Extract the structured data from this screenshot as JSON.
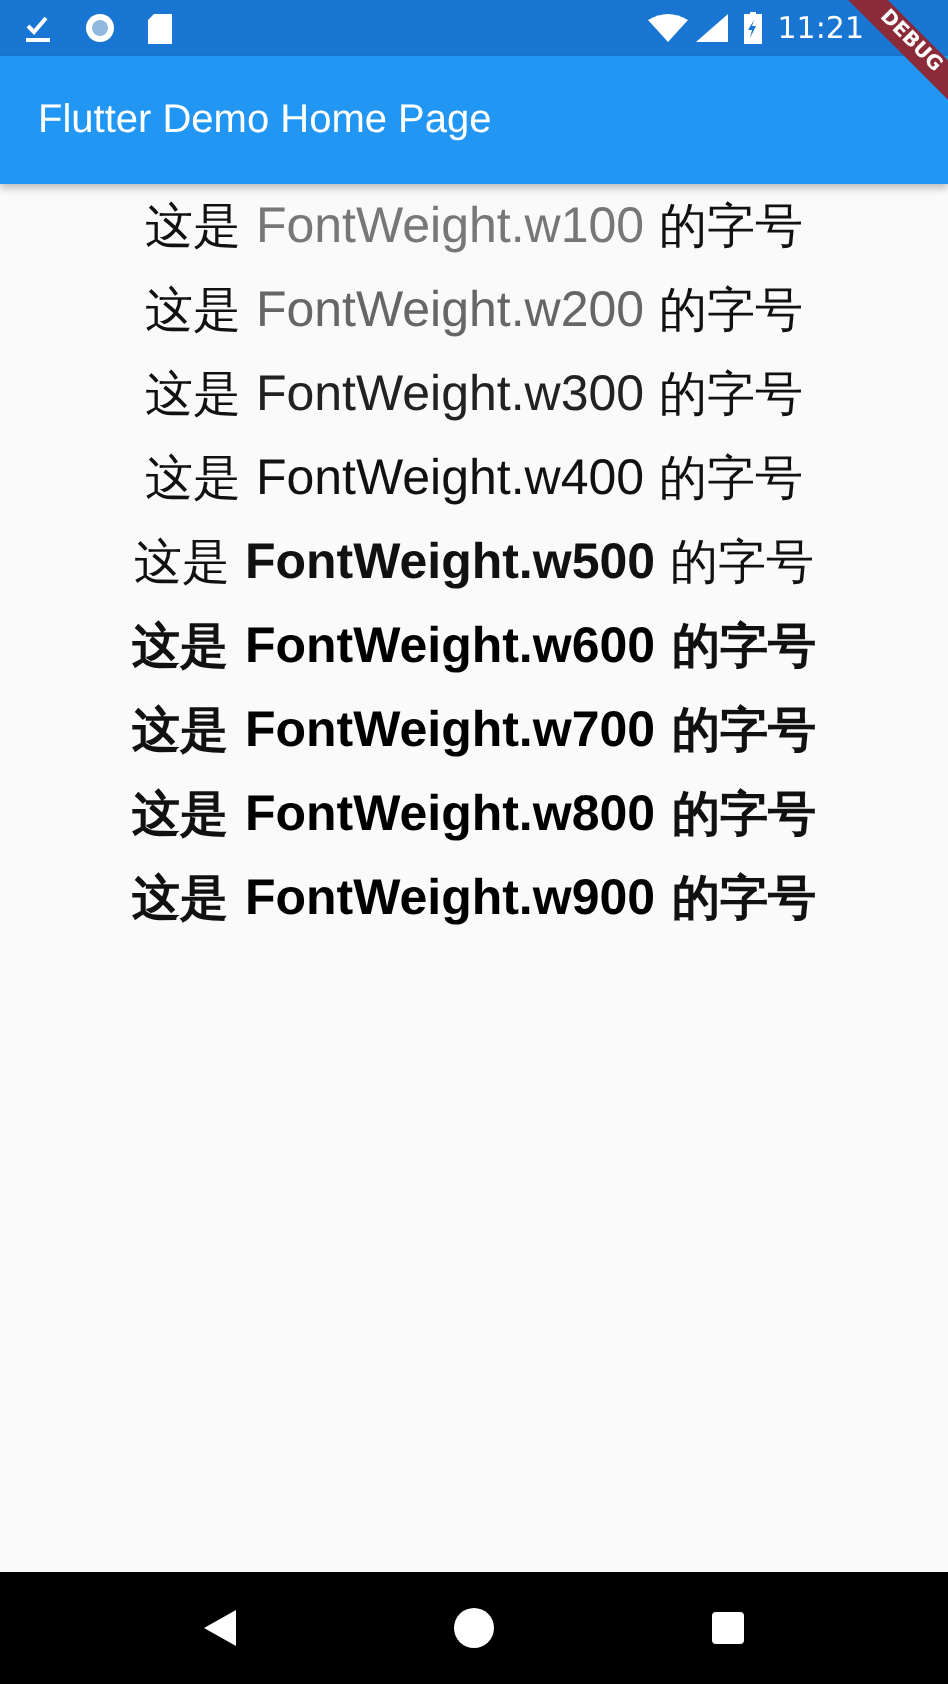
{
  "status_bar": {
    "time": "11:21"
  },
  "app_bar": {
    "title": "Flutter Demo Home Page"
  },
  "debug_banner": {
    "label": "DEBUG"
  },
  "lines": [
    {
      "prefix": "这是 ",
      "name": "FontWeight.w100",
      "suffix": " 的字号",
      "kind": "thin"
    },
    {
      "prefix": "这是 ",
      "name": "FontWeight.w200",
      "suffix": " 的字号",
      "kind": "extralight"
    },
    {
      "prefix": "这是 ",
      "name": "FontWeight.w300",
      "suffix": " 的字号",
      "kind": "light"
    },
    {
      "prefix": "这是 ",
      "name": "FontWeight.w400",
      "suffix": " 的字号",
      "kind": "regular"
    },
    {
      "prefix": "这是 ",
      "name": "FontWeight.w500",
      "suffix": " 的字号",
      "kind": "medium"
    },
    {
      "prefix": "这是 ",
      "name": "FontWeight.w600",
      "suffix": " 的字号",
      "kind": "semibold"
    },
    {
      "prefix": "这是 ",
      "name": "FontWeight.w700",
      "suffix": " 的字号",
      "kind": "bold"
    },
    {
      "prefix": "这是 ",
      "name": "FontWeight.w800",
      "suffix": " 的字号",
      "kind": "extrabold"
    },
    {
      "prefix": "这是 ",
      "name": "FontWeight.w900",
      "suffix": " 的字号",
      "kind": "black"
    }
  ]
}
